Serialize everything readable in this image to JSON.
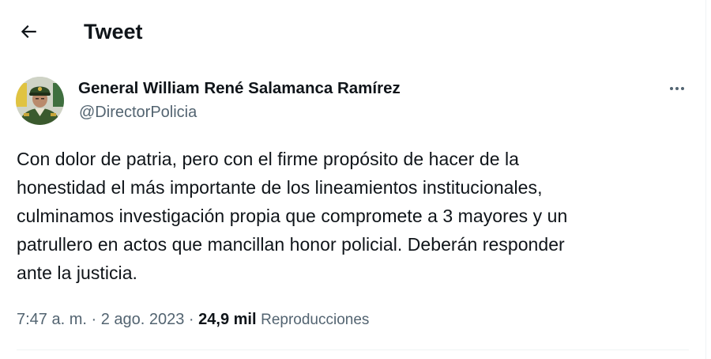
{
  "header": {
    "back_icon": "arrow-left-icon",
    "title": "Tweet"
  },
  "author": {
    "name": "General William René Salamanca Ramírez",
    "handle": "@DirectorPolicia",
    "avatar_icon": "profile-photo"
  },
  "more_icon": "more-horizontal-icon",
  "tweet": {
    "lines": [
      "Con dolor de patria, pero con el firme propósito de hacer de la",
      "honestidad el más importante de los lineamientos institucionales,",
      "culminamos investigación propia que compromete a 3 mayores y un",
      "patrullero en actos que mancillan honor policial. Deberán responder",
      "ante la justicia."
    ]
  },
  "meta": {
    "time": "7:47 a. m.",
    "sep1": " · ",
    "date": "2 ago. 2023",
    "sep2": " · ",
    "views_count": "24,9 mil",
    "views_label": "Reproducciones"
  },
  "colors": {
    "text": "#0f1419",
    "secondary": "#536471",
    "divider": "#eff3f4"
  }
}
